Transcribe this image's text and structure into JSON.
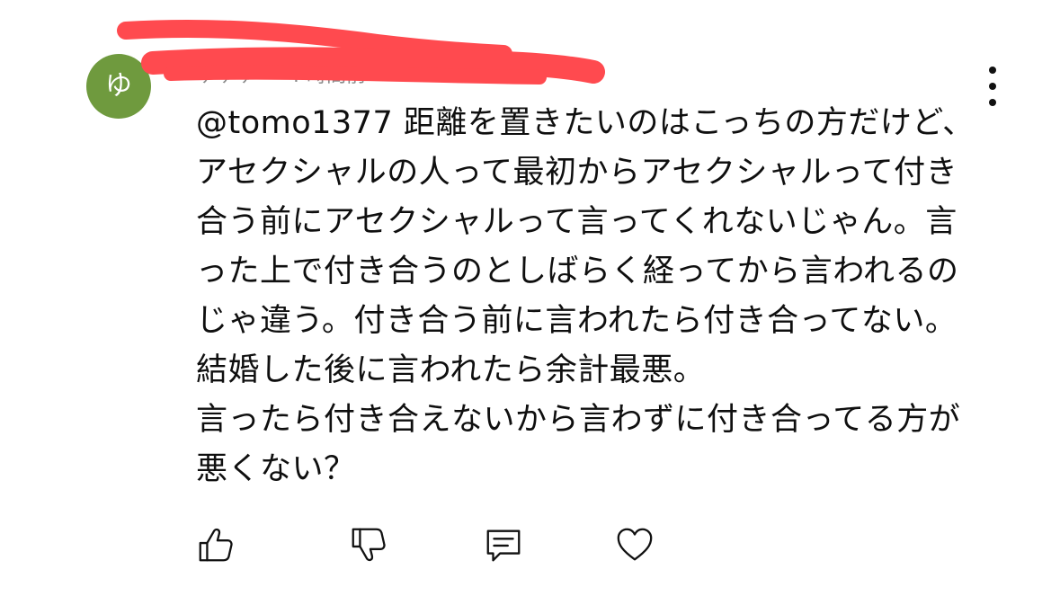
{
  "comment": {
    "author": {
      "avatar_letter": "ゆ",
      "avatar_color": "#6f9a3e",
      "name": "ゆゆゆ",
      "meta": "・ 4 時間前"
    },
    "redaction_color": "#ff4a4f",
    "text_paragraphs": [
      "@tomo1377 距離を置きたいのはこっちの方だけど、アセクシャルの人って最初からアセクシャルって付き合う前にアセクシャルって言ってくれないじゃん。言った上で付き合うのとしばらく経ってから言われるのじゃ違う。付き合う前に言われたら付き合ってない。結婚した後に言われたら余計最悪。",
      "言ったら付き合えないから言わずに付き合ってる方が悪くない？"
    ],
    "actions": [
      {
        "name": "like",
        "icon": "thumbs-up-icon"
      },
      {
        "name": "dislike",
        "icon": "thumbs-down-icon"
      },
      {
        "name": "reply",
        "icon": "comment-icon"
      },
      {
        "name": "heart",
        "icon": "heart-icon"
      }
    ],
    "menu_icon": "more-vertical-icon"
  }
}
